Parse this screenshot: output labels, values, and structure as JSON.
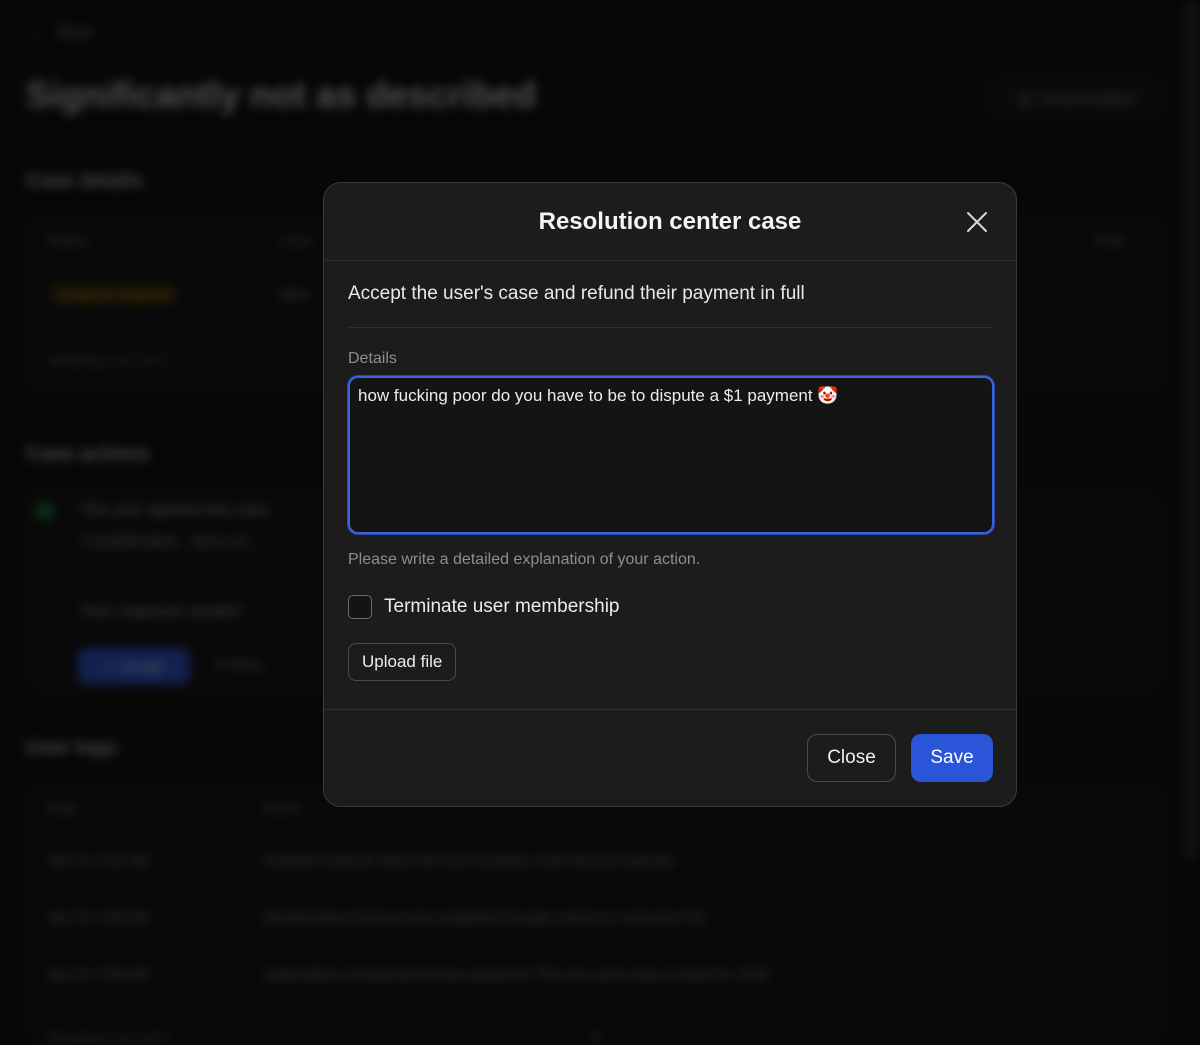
{
  "background": {
    "back_label": "Back",
    "page_title": "Significantly not as described",
    "documentation_label": "Documentation",
    "case_details_heading": "Case details",
    "case_table_headers": [
      "Status",
      "Case",
      "",
      "Date"
    ],
    "case_status_badge": "3 days to respond",
    "case_value": "Misc...",
    "showing_label": "Showing 1 to 1 of 1",
    "case_actions_heading": "Case actions",
    "action_opened": "The user opened this case",
    "action_opened_detail": "不是我要的服务，我怎么办...",
    "action_needed": "Your response needed",
    "accept_label": "Accept",
    "deny_label": "Deny",
    "user_logs_heading": "User logs",
    "logs_headers": [
      "Date",
      "Event"
    ],
    "logs": [
      {
        "date": "Apr 22, 3:16 AM",
        "event": "Emailed customer about the new resolution case they just opened."
      },
      {
        "date": "Apr 22, 2:58 AM",
        "event": "Membership checkout was completed through a direct to consumer link"
      },
      {
        "date": "Apr 22, 2:58 AM",
        "event": "Subscription renewal period has advanced. The new cycle ends on April 24, 2026"
      }
    ],
    "logs_showing_label": "Showing 1 to 3 of 3",
    "page_number": "1"
  },
  "modal": {
    "title": "Resolution center case",
    "close_icon": "close-icon",
    "action_description": "Accept the user's case and refund their payment in full",
    "details_label": "Details",
    "details_value": "how fucking poor do you have to be to dispute a $1 payment 🤡",
    "hint": "Please write a detailed explanation of your action.",
    "terminate_label": "Terminate user membership",
    "upload_label": "Upload file",
    "close_button": "Close",
    "save_button": "Save"
  },
  "colors": {
    "accent": "#2a55d8",
    "focus_border": "#3b63d9",
    "modal_bg": "#1c1c1c"
  }
}
